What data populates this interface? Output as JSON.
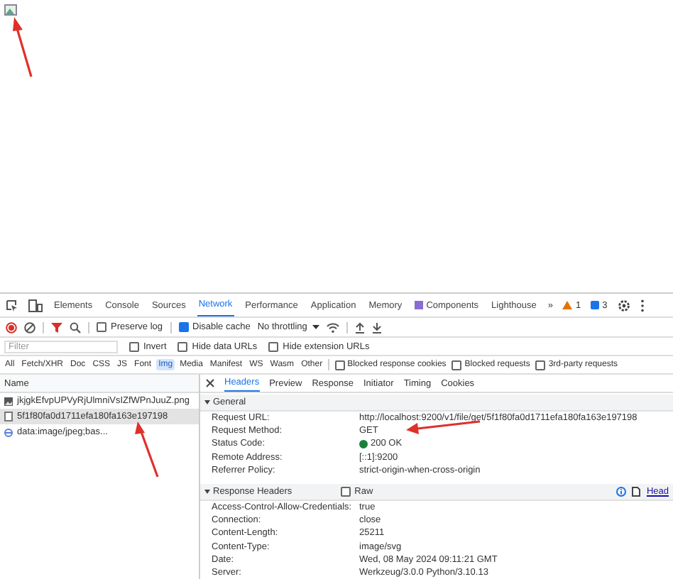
{
  "devtools": {
    "panel_tabs": [
      {
        "label": "Elements",
        "kind": "plain",
        "selected": false
      },
      {
        "label": "Console",
        "kind": "plain",
        "selected": false
      },
      {
        "label": "Sources",
        "kind": "plain",
        "selected": false
      },
      {
        "label": "Network",
        "kind": "plain",
        "selected": true
      },
      {
        "label": "Performance",
        "kind": "plain",
        "selected": false
      },
      {
        "label": "Application",
        "kind": "plain",
        "selected": false
      },
      {
        "label": "Memory",
        "kind": "plain",
        "selected": false
      },
      {
        "label": "Components",
        "kind": "extension",
        "selected": false
      },
      {
        "label": "Lighthouse",
        "kind": "plain",
        "selected": false
      }
    ],
    "more": "»",
    "warnings": "1",
    "issues": "3",
    "toolbar": {
      "preserve_log": {
        "label": "Preserve log",
        "checked": false
      },
      "disable_cache": {
        "label": "Disable cache",
        "checked": true
      },
      "throttling": "No throttling"
    },
    "filter": {
      "placeholder": "Filter",
      "options": [
        {
          "label": "Invert",
          "checked": false
        },
        {
          "label": "Hide data URLs",
          "checked": false
        },
        {
          "label": "Hide extension URLs",
          "checked": false
        }
      ]
    },
    "type_filters": [
      {
        "label": "All",
        "selected": false
      },
      {
        "label": "Fetch/XHR",
        "selected": false
      },
      {
        "label": "Doc",
        "selected": false
      },
      {
        "label": "CSS",
        "selected": false
      },
      {
        "label": "JS",
        "selected": false
      },
      {
        "label": "Font",
        "selected": false
      },
      {
        "label": "Img",
        "selected": true
      },
      {
        "label": "Media",
        "selected": false
      },
      {
        "label": "Manifest",
        "selected": false
      },
      {
        "label": "WS",
        "selected": false
      },
      {
        "label": "Wasm",
        "selected": false
      },
      {
        "label": "Other",
        "selected": false
      }
    ],
    "type_options": [
      {
        "label": "Blocked response cookies",
        "checked": false
      },
      {
        "label": "Blocked requests",
        "checked": false
      },
      {
        "label": "3rd-party requests",
        "checked": false
      }
    ],
    "requests": {
      "column": "Name",
      "rows": [
        {
          "name": "jkjgkEfvpUPVyRjUlmniVsIZfWPnJuuZ.png",
          "kind": "image",
          "selected": false
        },
        {
          "name": "5f1f80fa0d1711efa180fa163e197198",
          "kind": "document",
          "selected": true
        },
        {
          "name": "data:image/jpeg;bas...",
          "kind": "data",
          "selected": false
        }
      ]
    },
    "detail_tabs": [
      {
        "label": "Headers",
        "selected": true
      },
      {
        "label": "Preview",
        "selected": false
      },
      {
        "label": "Response",
        "selected": false
      },
      {
        "label": "Initiator",
        "selected": false
      },
      {
        "label": "Timing",
        "selected": false
      },
      {
        "label": "Cookies",
        "selected": false
      }
    ],
    "general": {
      "title": "General",
      "expanded": true,
      "rows": [
        {
          "key": "Request URL:",
          "value": "http://localhost:9200/v1/file/get/5f1f80fa0d1711efa180fa163e197198",
          "kind": "text"
        },
        {
          "key": "Request Method:",
          "value": "GET",
          "kind": "text"
        },
        {
          "key": "Status Code:",
          "value": "200 OK",
          "kind": "status"
        },
        {
          "key": "Remote Address:",
          "value": "[::1]:9200",
          "kind": "text"
        },
        {
          "key": "Referrer Policy:",
          "value": "strict-origin-when-cross-origin",
          "kind": "text"
        }
      ]
    },
    "response_headers": {
      "title": "Response Headers",
      "expanded": true,
      "raw": {
        "label": "Raw",
        "checked": false
      },
      "link": "Head",
      "rows": [
        {
          "key": "Access-Control-Allow-Credentials:",
          "value": "true"
        },
        {
          "key": "Connection:",
          "value": "close"
        },
        {
          "key": "Content-Length:",
          "value": "25211"
        },
        {
          "key": "Content-Type:",
          "value": "image/svg"
        },
        {
          "key": "Date:",
          "value": "Wed, 08 May 2024 09:11:21 GMT"
        },
        {
          "key": "Server:",
          "value": "Werkzeug/3.0.0 Python/3.10.13"
        }
      ]
    }
  }
}
